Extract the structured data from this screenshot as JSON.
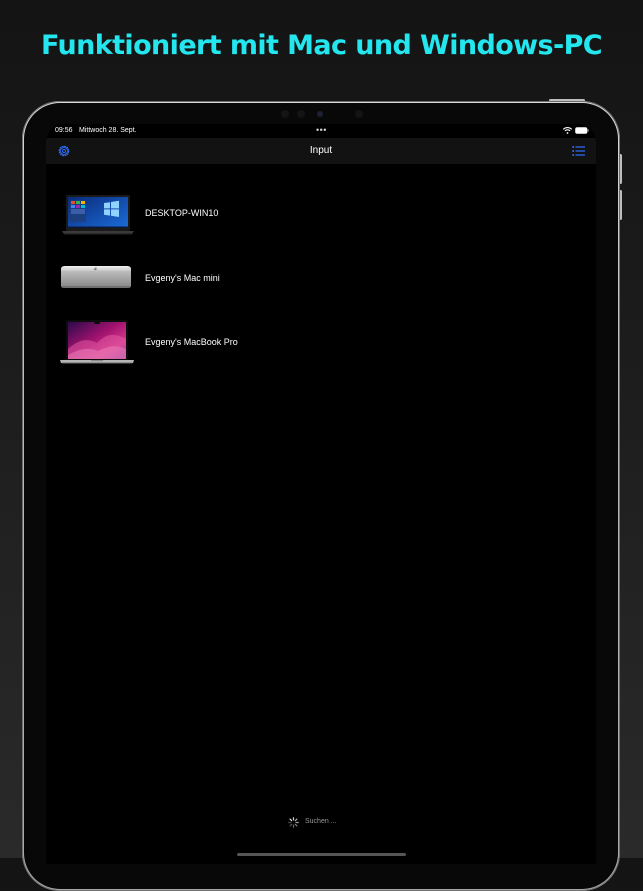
{
  "headline": "Funktioniert mit Mac und Windows-PC",
  "colors": {
    "headline": "#23e6ee",
    "accent": "#2f6fff",
    "background": "#000000",
    "nav_bar": "#121212"
  },
  "status_bar": {
    "time": "09:56",
    "date": "Mittwoch 28. Sept.",
    "multitask": "•••",
    "icons": [
      "wifi-icon",
      "battery-icon"
    ]
  },
  "nav": {
    "title": "Input",
    "left_icon": "gear-icon",
    "right_icon": "list-icon"
  },
  "devices": [
    {
      "name": "DESKTOP-WIN10",
      "icon": "windows-laptop-icon"
    },
    {
      "name": "Evgeny's Mac mini",
      "icon": "mac-mini-icon"
    },
    {
      "name": "Evgeny's MacBook Pro",
      "icon": "macbook-pro-icon"
    }
  ],
  "footer": {
    "searching_label": "Suchen ...",
    "icon": "spinner-icon"
  }
}
